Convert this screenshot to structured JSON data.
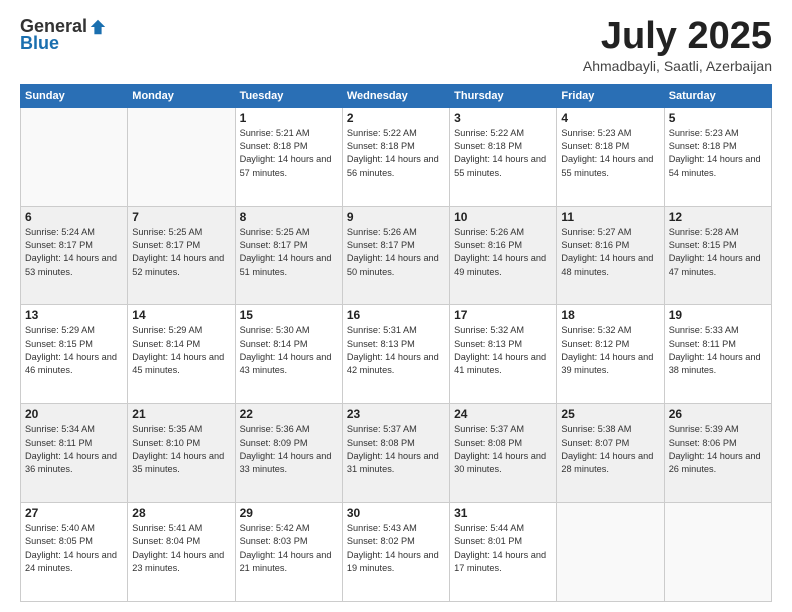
{
  "header": {
    "logo_general": "General",
    "logo_blue": "Blue",
    "month": "July 2025",
    "location": "Ahmadbayli, Saatli, Azerbaijan"
  },
  "weekdays": [
    "Sunday",
    "Monday",
    "Tuesday",
    "Wednesday",
    "Thursday",
    "Friday",
    "Saturday"
  ],
  "weeks": [
    [
      {
        "day": "",
        "info": ""
      },
      {
        "day": "",
        "info": ""
      },
      {
        "day": "1",
        "info": "Sunrise: 5:21 AM\nSunset: 8:18 PM\nDaylight: 14 hours and 57 minutes."
      },
      {
        "day": "2",
        "info": "Sunrise: 5:22 AM\nSunset: 8:18 PM\nDaylight: 14 hours and 56 minutes."
      },
      {
        "day": "3",
        "info": "Sunrise: 5:22 AM\nSunset: 8:18 PM\nDaylight: 14 hours and 55 minutes."
      },
      {
        "day": "4",
        "info": "Sunrise: 5:23 AM\nSunset: 8:18 PM\nDaylight: 14 hours and 55 minutes."
      },
      {
        "day": "5",
        "info": "Sunrise: 5:23 AM\nSunset: 8:18 PM\nDaylight: 14 hours and 54 minutes."
      }
    ],
    [
      {
        "day": "6",
        "info": "Sunrise: 5:24 AM\nSunset: 8:17 PM\nDaylight: 14 hours and 53 minutes."
      },
      {
        "day": "7",
        "info": "Sunrise: 5:25 AM\nSunset: 8:17 PM\nDaylight: 14 hours and 52 minutes."
      },
      {
        "day": "8",
        "info": "Sunrise: 5:25 AM\nSunset: 8:17 PM\nDaylight: 14 hours and 51 minutes."
      },
      {
        "day": "9",
        "info": "Sunrise: 5:26 AM\nSunset: 8:17 PM\nDaylight: 14 hours and 50 minutes."
      },
      {
        "day": "10",
        "info": "Sunrise: 5:26 AM\nSunset: 8:16 PM\nDaylight: 14 hours and 49 minutes."
      },
      {
        "day": "11",
        "info": "Sunrise: 5:27 AM\nSunset: 8:16 PM\nDaylight: 14 hours and 48 minutes."
      },
      {
        "day": "12",
        "info": "Sunrise: 5:28 AM\nSunset: 8:15 PM\nDaylight: 14 hours and 47 minutes."
      }
    ],
    [
      {
        "day": "13",
        "info": "Sunrise: 5:29 AM\nSunset: 8:15 PM\nDaylight: 14 hours and 46 minutes."
      },
      {
        "day": "14",
        "info": "Sunrise: 5:29 AM\nSunset: 8:14 PM\nDaylight: 14 hours and 45 minutes."
      },
      {
        "day": "15",
        "info": "Sunrise: 5:30 AM\nSunset: 8:14 PM\nDaylight: 14 hours and 43 minutes."
      },
      {
        "day": "16",
        "info": "Sunrise: 5:31 AM\nSunset: 8:13 PM\nDaylight: 14 hours and 42 minutes."
      },
      {
        "day": "17",
        "info": "Sunrise: 5:32 AM\nSunset: 8:13 PM\nDaylight: 14 hours and 41 minutes."
      },
      {
        "day": "18",
        "info": "Sunrise: 5:32 AM\nSunset: 8:12 PM\nDaylight: 14 hours and 39 minutes."
      },
      {
        "day": "19",
        "info": "Sunrise: 5:33 AM\nSunset: 8:11 PM\nDaylight: 14 hours and 38 minutes."
      }
    ],
    [
      {
        "day": "20",
        "info": "Sunrise: 5:34 AM\nSunset: 8:11 PM\nDaylight: 14 hours and 36 minutes."
      },
      {
        "day": "21",
        "info": "Sunrise: 5:35 AM\nSunset: 8:10 PM\nDaylight: 14 hours and 35 minutes."
      },
      {
        "day": "22",
        "info": "Sunrise: 5:36 AM\nSunset: 8:09 PM\nDaylight: 14 hours and 33 minutes."
      },
      {
        "day": "23",
        "info": "Sunrise: 5:37 AM\nSunset: 8:08 PM\nDaylight: 14 hours and 31 minutes."
      },
      {
        "day": "24",
        "info": "Sunrise: 5:37 AM\nSunset: 8:08 PM\nDaylight: 14 hours and 30 minutes."
      },
      {
        "day": "25",
        "info": "Sunrise: 5:38 AM\nSunset: 8:07 PM\nDaylight: 14 hours and 28 minutes."
      },
      {
        "day": "26",
        "info": "Sunrise: 5:39 AM\nSunset: 8:06 PM\nDaylight: 14 hours and 26 minutes."
      }
    ],
    [
      {
        "day": "27",
        "info": "Sunrise: 5:40 AM\nSunset: 8:05 PM\nDaylight: 14 hours and 24 minutes."
      },
      {
        "day": "28",
        "info": "Sunrise: 5:41 AM\nSunset: 8:04 PM\nDaylight: 14 hours and 23 minutes."
      },
      {
        "day": "29",
        "info": "Sunrise: 5:42 AM\nSunset: 8:03 PM\nDaylight: 14 hours and 21 minutes."
      },
      {
        "day": "30",
        "info": "Sunrise: 5:43 AM\nSunset: 8:02 PM\nDaylight: 14 hours and 19 minutes."
      },
      {
        "day": "31",
        "info": "Sunrise: 5:44 AM\nSunset: 8:01 PM\nDaylight: 14 hours and 17 minutes."
      },
      {
        "day": "",
        "info": ""
      },
      {
        "day": "",
        "info": ""
      }
    ]
  ]
}
